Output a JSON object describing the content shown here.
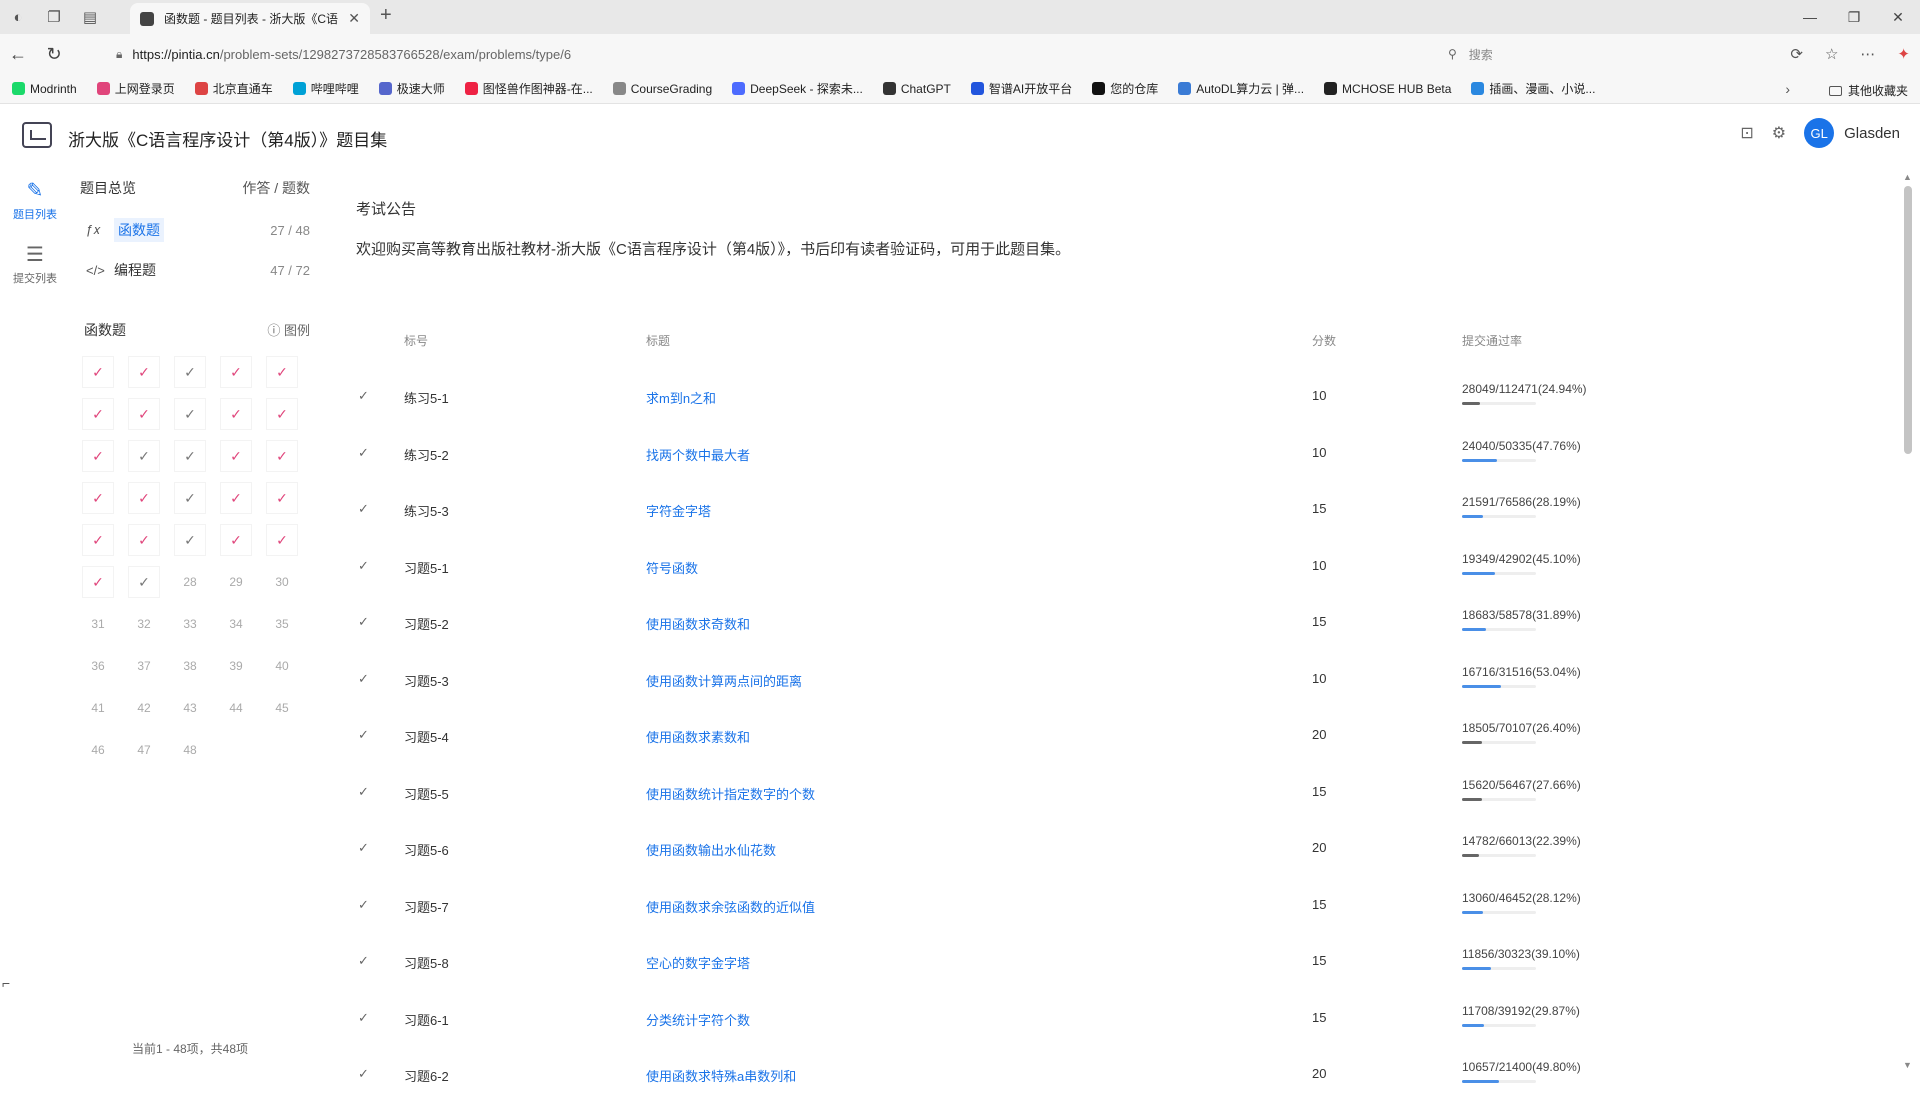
{
  "browser": {
    "tab_title": "函数题 - 题目列表 - 浙大版《C语",
    "url_host": "https://pintia.cn",
    "url_path": "/problem-sets/12982737285837665​28/exam/problems/type/6",
    "search_placeholder": "搜索",
    "bookmarks": [
      {
        "label": "Modrinth",
        "color": "#1bd96a"
      },
      {
        "label": "上网登录页",
        "color": "#e0457b"
      },
      {
        "label": "北京直通车",
        "color": "#d44"
      },
      {
        "label": "哔哩哔哩",
        "color": "#00a1d6"
      },
      {
        "label": "极速大师",
        "color": "#5566cc"
      },
      {
        "label": "图怪兽作图神器-在...",
        "color": "#e24"
      },
      {
        "label": "CourseGrading",
        "color": "#888"
      },
      {
        "label": "DeepSeek - 探索未...",
        "color": "#4d6bfe"
      },
      {
        "label": "ChatGPT",
        "color": "#333"
      },
      {
        "label": "智谱AI开放平台",
        "color": "#2255dd"
      },
      {
        "label": "您的仓库",
        "color": "#111"
      },
      {
        "label": "AutoDL算力云 | 弹...",
        "color": "#3a7bd5"
      },
      {
        "label": "MCHOSE HUB Beta",
        "color": "#222"
      },
      {
        "label": "插画、漫画、小说...",
        "color": "#2a88e0"
      }
    ],
    "bookmarks_folder": "其他收藏夹"
  },
  "header": {
    "title": "浙大版《C语言程序设计（第4版）》题目集",
    "user_initials": "GL",
    "user_name": "Glasden"
  },
  "rail": {
    "problems_label": "题目列表",
    "submissions_label": "提交列表"
  },
  "side": {
    "overview_label": "题目总览",
    "answered_label": "作答 / 题数",
    "types": [
      {
        "label": "函数题",
        "count": "27 / 48"
      },
      {
        "label": "编程题",
        "count": "47 / 72"
      }
    ],
    "grid_title": "函数题",
    "legend_label": "图例",
    "cells": [
      {
        "t": "✓",
        "s": "ok"
      },
      {
        "t": "✓",
        "s": "ok"
      },
      {
        "t": "✓",
        "s": "ok grey"
      },
      {
        "t": "✓",
        "s": "ok"
      },
      {
        "t": "✓",
        "s": "ok"
      },
      {
        "t": "✓",
        "s": "ok"
      },
      {
        "t": "✓",
        "s": "ok"
      },
      {
        "t": "✓",
        "s": "ok grey"
      },
      {
        "t": "✓",
        "s": "ok"
      },
      {
        "t": "✓",
        "s": "ok"
      },
      {
        "t": "✓",
        "s": "ok"
      },
      {
        "t": "✓",
        "s": "ok grey"
      },
      {
        "t": "✓",
        "s": "ok grey"
      },
      {
        "t": "✓",
        "s": "ok"
      },
      {
        "t": "✓",
        "s": "ok"
      },
      {
        "t": "✓",
        "s": "ok"
      },
      {
        "t": "✓",
        "s": "ok"
      },
      {
        "t": "✓",
        "s": "ok grey"
      },
      {
        "t": "✓",
        "s": "ok"
      },
      {
        "t": "✓",
        "s": "ok"
      },
      {
        "t": "✓",
        "s": "ok"
      },
      {
        "t": "✓",
        "s": "ok"
      },
      {
        "t": "✓",
        "s": "ok grey"
      },
      {
        "t": "✓",
        "s": "ok"
      },
      {
        "t": "✓",
        "s": "ok"
      },
      {
        "t": "✓",
        "s": "ok"
      },
      {
        "t": "✓",
        "s": "ok grey"
      },
      {
        "t": "28",
        "s": ""
      },
      {
        "t": "29",
        "s": ""
      },
      {
        "t": "30",
        "s": ""
      },
      {
        "t": "31",
        "s": ""
      },
      {
        "t": "32",
        "s": ""
      },
      {
        "t": "33",
        "s": ""
      },
      {
        "t": "34",
        "s": ""
      },
      {
        "t": "35",
        "s": ""
      },
      {
        "t": "36",
        "s": ""
      },
      {
        "t": "37",
        "s": ""
      },
      {
        "t": "38",
        "s": ""
      },
      {
        "t": "39",
        "s": ""
      },
      {
        "t": "40",
        "s": ""
      },
      {
        "t": "41",
        "s": ""
      },
      {
        "t": "42",
        "s": ""
      },
      {
        "t": "43",
        "s": ""
      },
      {
        "t": "44",
        "s": ""
      },
      {
        "t": "45",
        "s": ""
      },
      {
        "t": "46",
        "s": ""
      },
      {
        "t": "47",
        "s": ""
      },
      {
        "t": "48",
        "s": ""
      }
    ],
    "footer": "当前1 - 48项，共48项"
  },
  "main": {
    "notice_title": "考试公告",
    "notice_text": "欢迎购买高等教育出版社教材-浙大版《C语言程序设计（第4版）》，书后印有读者验证码，可用于此题目集。",
    "columns": {
      "no": "标号",
      "title": "标题",
      "score": "分数",
      "rate": "提交通过率"
    },
    "rows": [
      {
        "no": "练习5-1",
        "title": "求m到n之和",
        "score": "10",
        "rate": "28049/112471(24.94%)",
        "pct": 24.94
      },
      {
        "no": "练习5-2",
        "title": "找两个数中最大者",
        "score": "10",
        "rate": "24040/50335(47.76%)",
        "pct": 47.76
      },
      {
        "no": "练习5-3",
        "title": "字符金字塔",
        "score": "15",
        "rate": "21591/76586(28.19%)",
        "pct": 28.19
      },
      {
        "no": "习题5-1",
        "title": "符号函数",
        "score": "10",
        "rate": "19349/42902(45.10%)",
        "pct": 45.1
      },
      {
        "no": "习题5-2",
        "title": "使用函数求奇数和",
        "score": "15",
        "rate": "18683/58578(31.89%)",
        "pct": 31.89
      },
      {
        "no": "习题5-3",
        "title": "使用函数计算两点间的距离",
        "score": "10",
        "rate": "16716/31516(53.04%)",
        "pct": 53.04
      },
      {
        "no": "习题5-4",
        "title": "使用函数求素数和",
        "score": "20",
        "rate": "18505/70107(26.40%)",
        "pct": 26.4
      },
      {
        "no": "习题5-5",
        "title": "使用函数统计指定数字的个数",
        "score": "15",
        "rate": "15620/56467(27.66%)",
        "pct": 27.66
      },
      {
        "no": "习题5-6",
        "title": "使用函数输出水仙花数",
        "score": "20",
        "rate": "14782/66013(22.39%)",
        "pct": 22.39
      },
      {
        "no": "习题5-7",
        "title": "使用函数求余弦函数的近似值",
        "score": "15",
        "rate": "13060/46452(28.12%)",
        "pct": 28.12
      },
      {
        "no": "习题5-8",
        "title": "空心的数字金字塔",
        "score": "15",
        "rate": "11856/30323(39.10%)",
        "pct": 39.1
      },
      {
        "no": "习题6-1",
        "title": "分类统计字符个数",
        "score": "15",
        "rate": "11708/39192(29.87%)",
        "pct": 29.87
      },
      {
        "no": "习题6-2",
        "title": "使用函数求特殊a串数列和",
        "score": "20",
        "rate": "10657/21400(49.80%)",
        "pct": 49.8
      }
    ]
  }
}
